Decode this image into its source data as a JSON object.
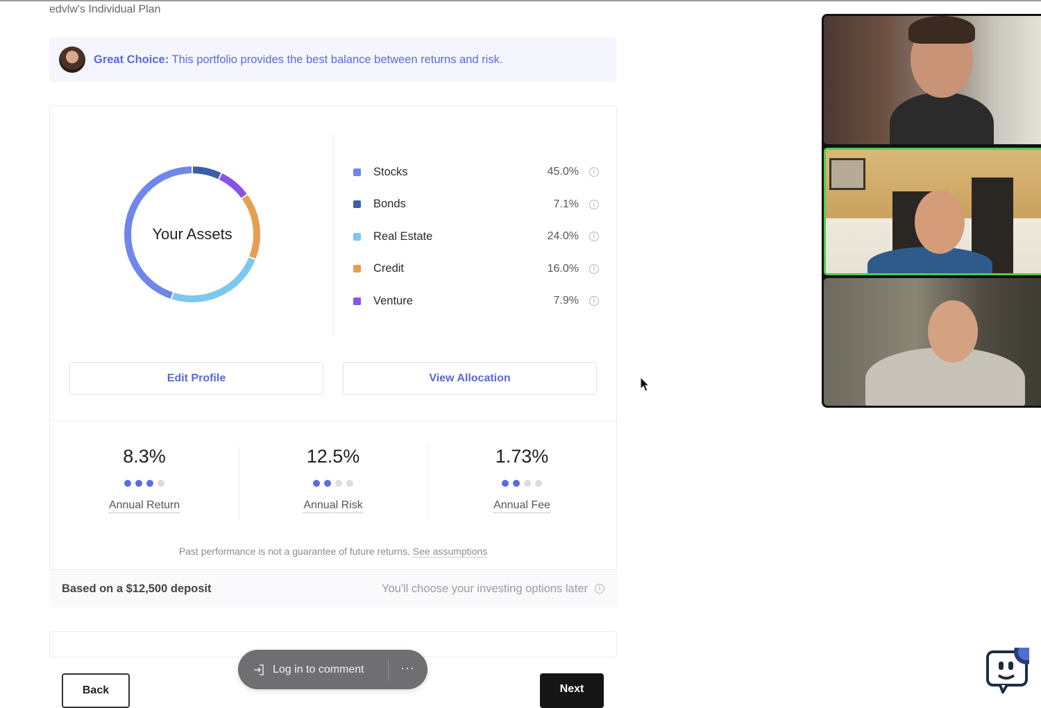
{
  "page": {
    "plan_title": "edvlw's Individual Plan"
  },
  "banner": {
    "strong": "Great Choice:",
    "message": " This portfolio provides the best balance between returns and risk."
  },
  "allocation": {
    "center_label": "Your Assets",
    "items": [
      {
        "name": "Stocks",
        "percent": "45.0%",
        "value": 45.0,
        "color": "#6f86ea"
      },
      {
        "name": "Bonds",
        "percent": "7.1%",
        "value": 7.1,
        "color": "#3a5fa8"
      },
      {
        "name": "Real Estate",
        "percent": "24.0%",
        "value": 24.0,
        "color": "#7cc8f0"
      },
      {
        "name": "Credit",
        "percent": "16.0%",
        "value": 16.0,
        "color": "#e4a050"
      },
      {
        "name": "Venture",
        "percent": "7.9%",
        "value": 7.9,
        "color": "#8a52e6"
      }
    ],
    "donut_order": [
      "Bonds",
      "Venture",
      "Credit",
      "Real Estate",
      "Stocks"
    ]
  },
  "buttons": {
    "edit_profile": "Edit Profile",
    "view_allocation": "View Allocation",
    "back": "Back",
    "next": "Next"
  },
  "stats": [
    {
      "value": "8.3%",
      "label": "Annual Return",
      "level": 3,
      "max": 4
    },
    {
      "value": "12.5%",
      "label": "Annual Risk",
      "level": 2,
      "max": 4
    },
    {
      "value": "1.73%",
      "label": "Annual Fee",
      "level": 2,
      "max": 4
    }
  ],
  "disclaimer": {
    "text": "Past performance is not a guarantee of future returns. ",
    "link": "See assumptions"
  },
  "deposit": {
    "left": "Based on a $12,500 deposit",
    "right": "You'll choose your investing options later"
  },
  "comment": {
    "label": "Log in to comment",
    "more": "···"
  },
  "icons": {
    "info": "i"
  },
  "colors": {
    "accent": "#5b67dc",
    "active_speaker_border": "#4bd04b"
  }
}
